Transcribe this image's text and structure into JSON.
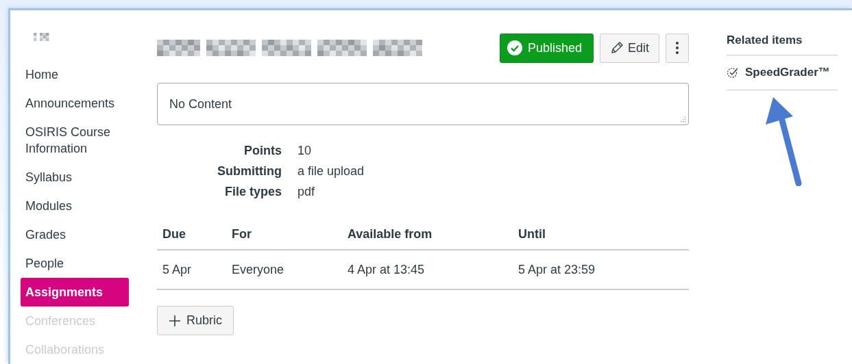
{
  "sidebar": {
    "items": [
      {
        "label": "Home",
        "selected": false,
        "disabled": false
      },
      {
        "label": "Announcements",
        "selected": false,
        "disabled": false
      },
      {
        "label": "OSIRIS Course Information",
        "selected": false,
        "disabled": false
      },
      {
        "label": "Syllabus",
        "selected": false,
        "disabled": false
      },
      {
        "label": "Modules",
        "selected": false,
        "disabled": false
      },
      {
        "label": "Grades",
        "selected": false,
        "disabled": false
      },
      {
        "label": "People",
        "selected": false,
        "disabled": false
      },
      {
        "label": "Assignments",
        "selected": true,
        "disabled": false
      },
      {
        "label": "Conferences",
        "selected": false,
        "disabled": true
      },
      {
        "label": "Collaborations",
        "selected": false,
        "disabled": true
      }
    ]
  },
  "header": {
    "published": {
      "label": "Published",
      "on": true
    },
    "edit": {
      "label": "Edit"
    }
  },
  "description": {
    "value": "No Content"
  },
  "details": [
    {
      "label": "Points",
      "value": "10"
    },
    {
      "label": "Submitting",
      "value": "a file upload"
    },
    {
      "label": "File types",
      "value": "pdf"
    }
  ],
  "dates_table": {
    "columns": [
      "Due",
      "For",
      "Available from",
      "Until"
    ],
    "rows": [
      [
        "5 Apr",
        "Everyone",
        "4 Apr at 13:45",
        "5 Apr at 23:59"
      ]
    ]
  },
  "rubric_button": {
    "label": "Rubric"
  },
  "related": {
    "title": "Related items",
    "items": [
      {
        "label": "SpeedGrader™"
      }
    ]
  }
}
